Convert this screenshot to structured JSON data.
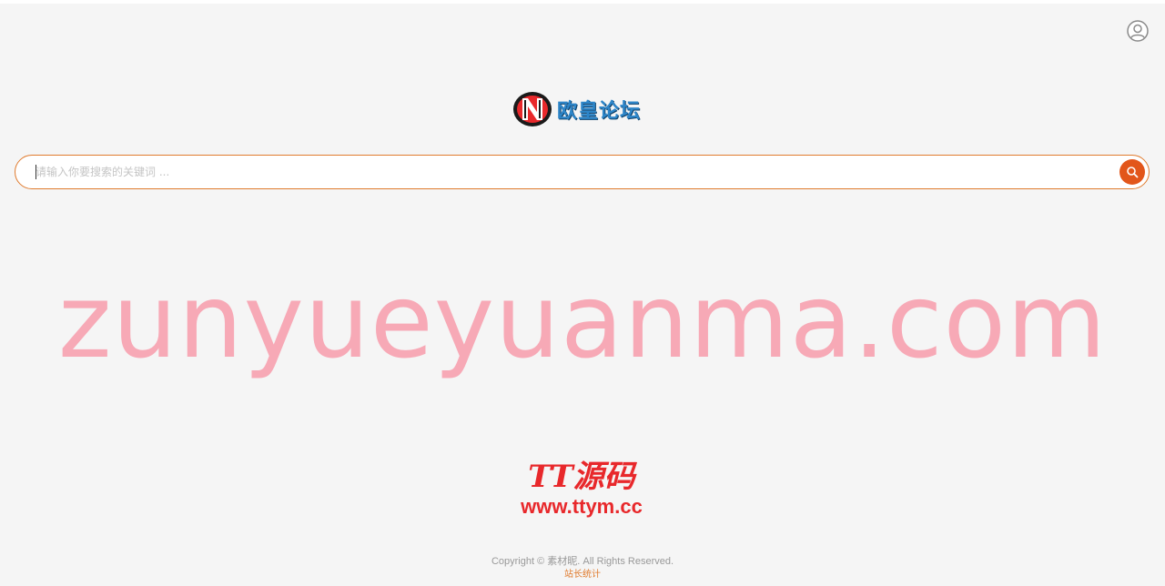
{
  "header": {
    "user_icon": "user-avatar-icon"
  },
  "logo": {
    "text": "欧皇论坛",
    "icon": "n-letter-logo-icon",
    "colors": {
      "mark_red": "#e8282b",
      "mark_dark": "#1a1a1a",
      "text_blue": "#2e86c9"
    }
  },
  "search": {
    "placeholder": "请输入你要搜索的关键词 ...",
    "value": "",
    "button_icon": "search-icon",
    "colors": {
      "border": "#e07b2e",
      "button": "#e2561a"
    }
  },
  "watermark": {
    "text": "zunyueyuanma.com",
    "color": "#f7a9b6"
  },
  "badge": {
    "title": "TT源码",
    "url": "www.ttym.cc",
    "color": "#e8282b"
  },
  "footer": {
    "copyright": "Copyright © 素材昵. All Rights Reserved.",
    "link_label": "站长统计"
  }
}
